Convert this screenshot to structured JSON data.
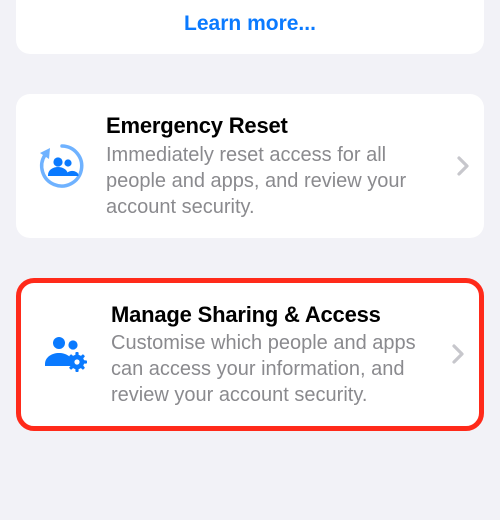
{
  "learn_more": {
    "label": "Learn more..."
  },
  "emergency": {
    "title": "Emergency Reset",
    "subtitle": "Immediately reset access for all people and apps, and review your account security."
  },
  "manage": {
    "title": "Manage Sharing & Access",
    "subtitle": "Customise which people and apps can access your information, and review your account security."
  },
  "colors": {
    "accent": "#0a7aff",
    "text_secondary": "#8a8a8e",
    "chevron": "#c7c7cc",
    "highlight": "#ff2a1a"
  }
}
